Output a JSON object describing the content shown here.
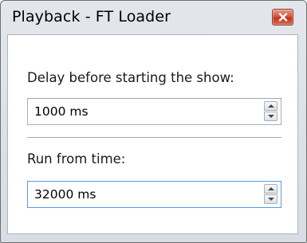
{
  "window": {
    "title": "Playback - FT Loader"
  },
  "delay": {
    "label": "Delay before starting the show:",
    "value": "1000 ms"
  },
  "run_from": {
    "label": "Run from time:",
    "value": "32000 ms"
  },
  "colors": {
    "close_button": "#d8553f",
    "focus_border": "#569de5"
  }
}
